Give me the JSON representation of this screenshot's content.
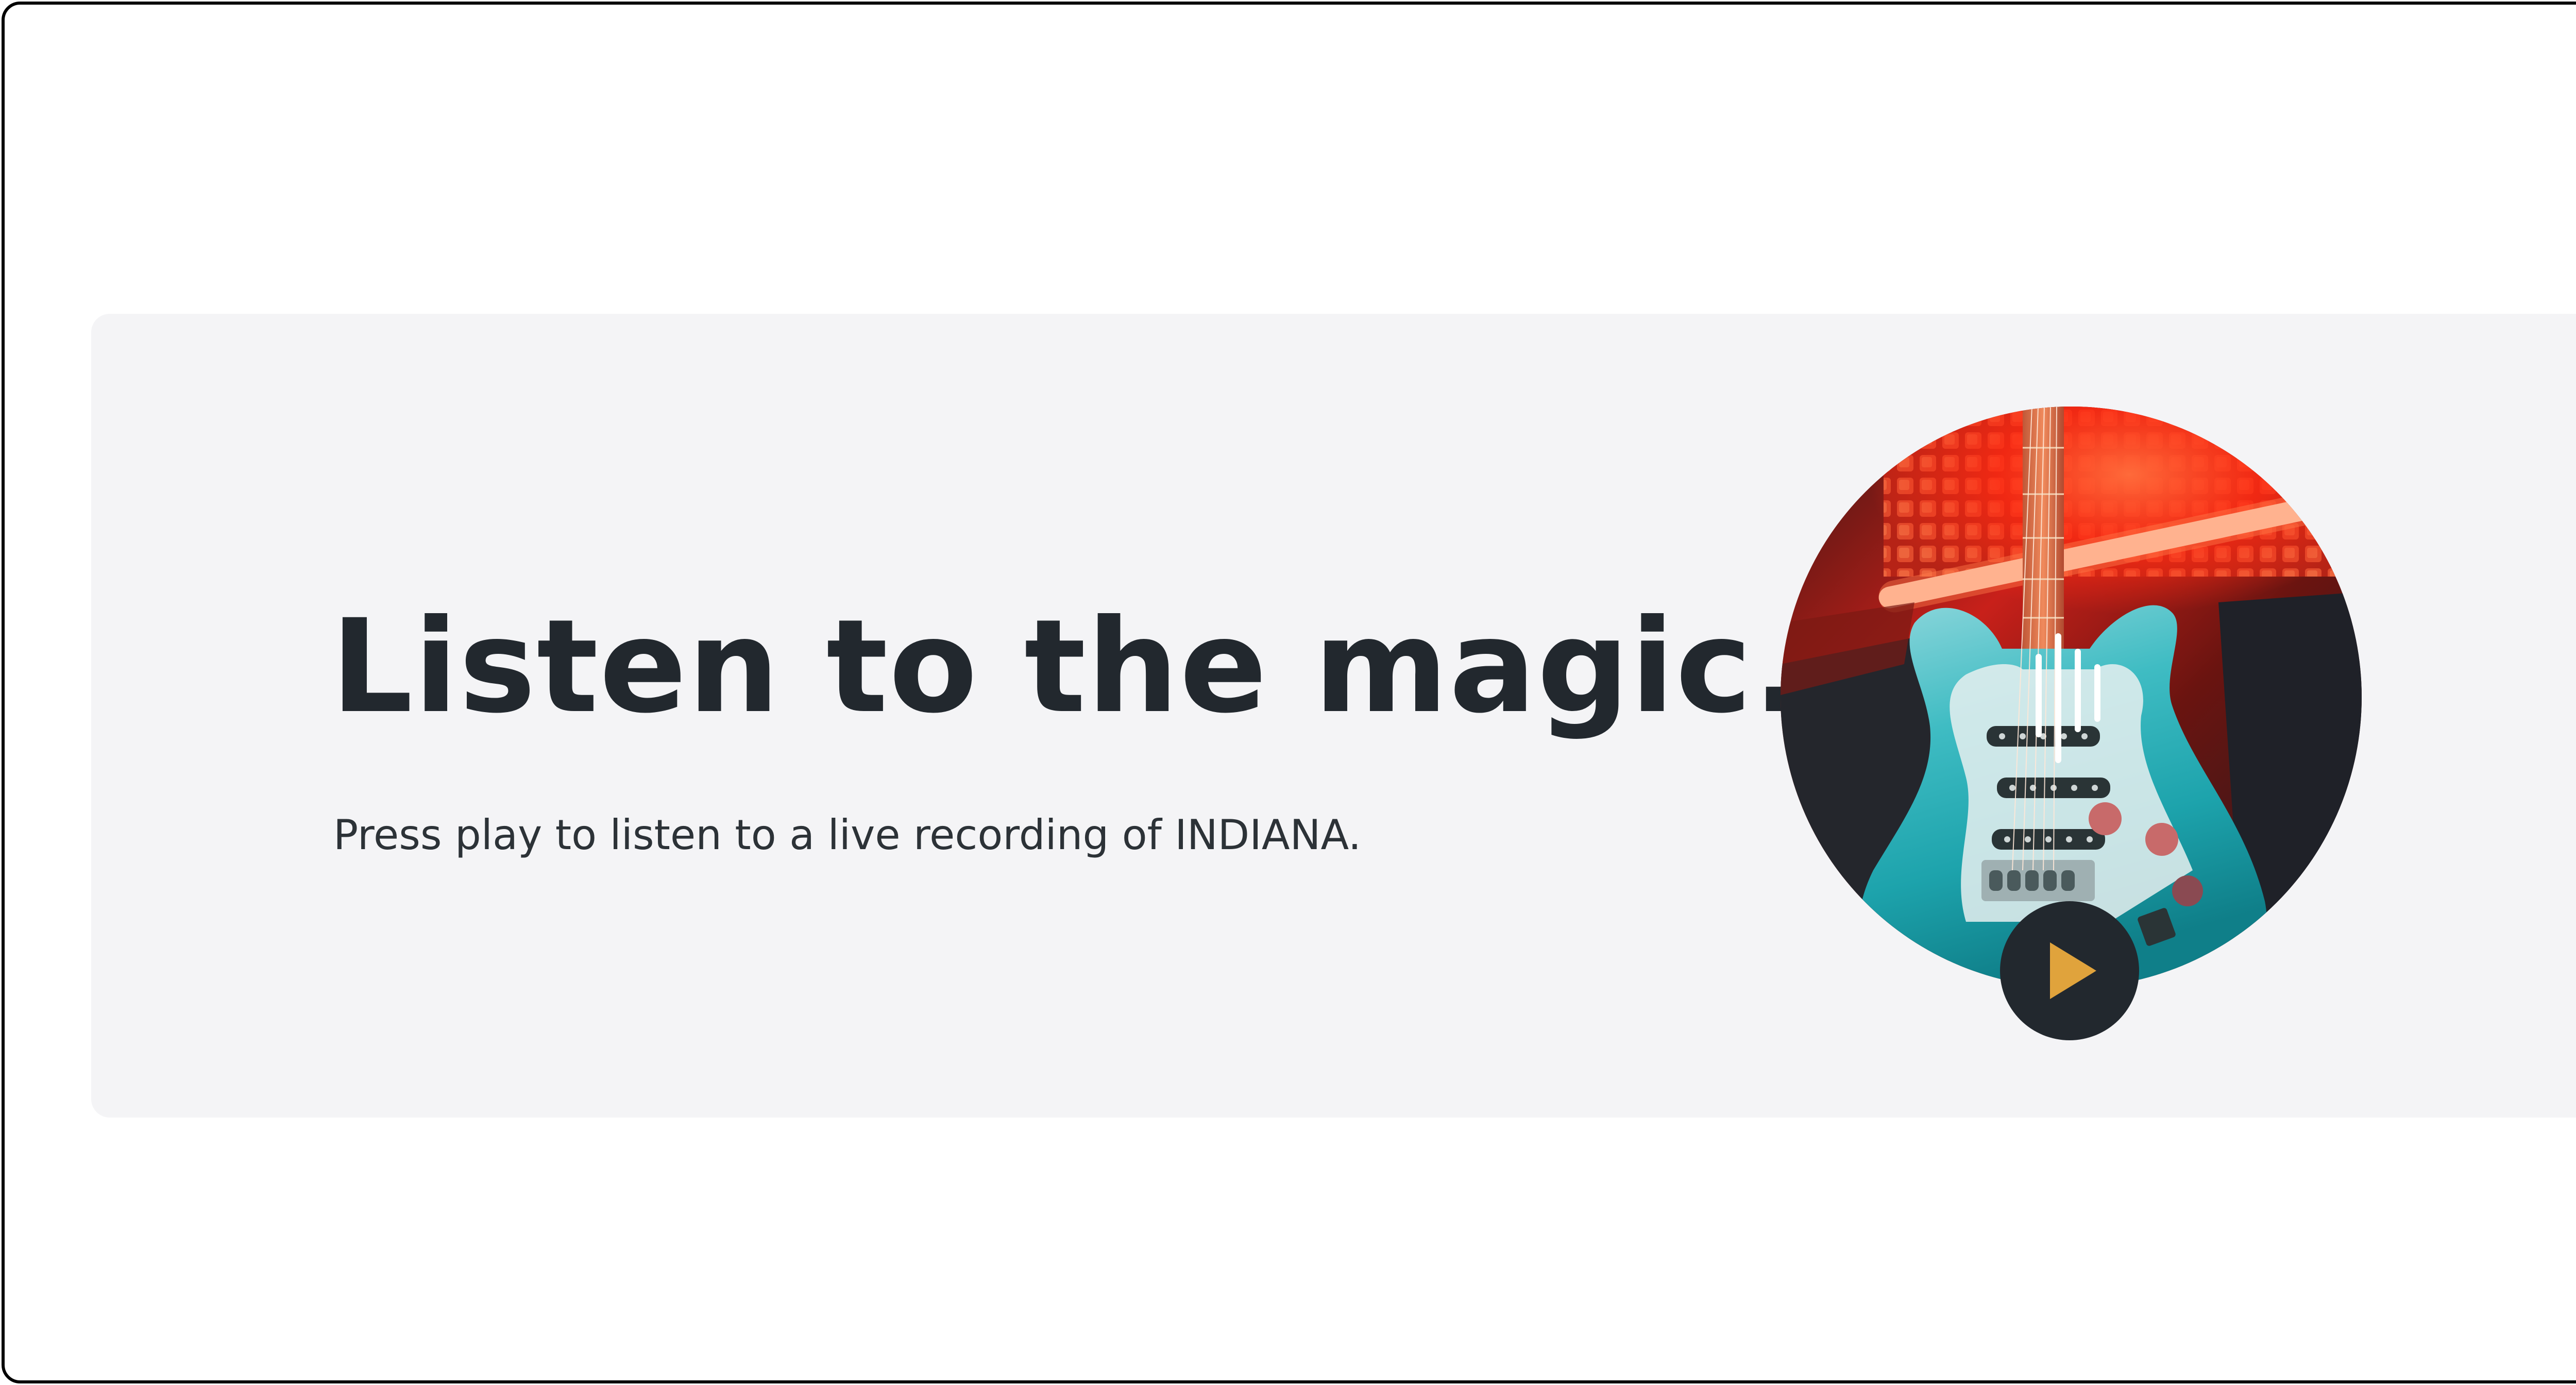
{
  "hero": {
    "title": "Listen to the magic.",
    "subtitle": "Press play to listen to a live recording of INDIANA."
  },
  "player": {
    "artwork": "guitar-photo",
    "overlay_icon": "audio-waveform-icon",
    "play_icon": "play-icon"
  },
  "colors": {
    "card_background": "#f4f4f6",
    "text_dark": "#22282e",
    "play_button": "#22282e",
    "play_triangle": "#e0a33c",
    "guitar_teal": "#2fb4bb",
    "neon_red": "#ff3b1f"
  }
}
